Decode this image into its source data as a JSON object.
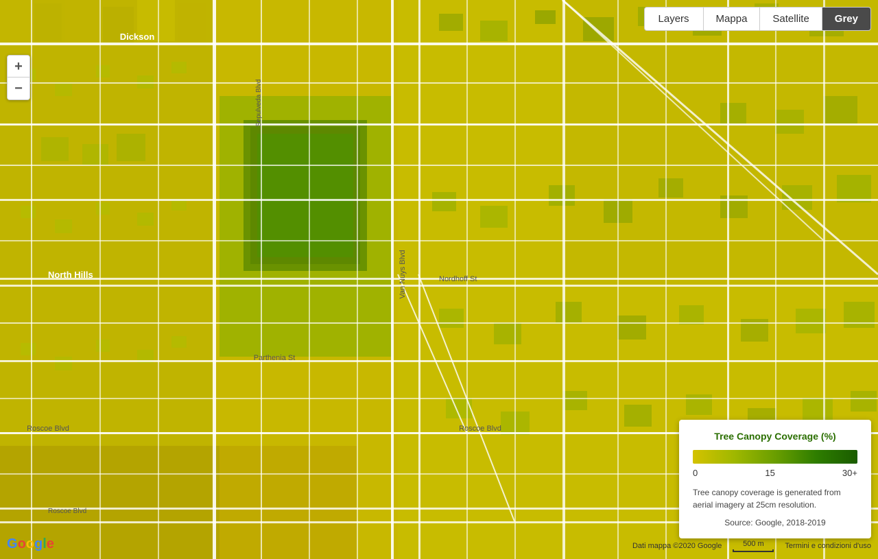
{
  "controls": {
    "layers_label": "Layers",
    "mappa_label": "Mappa",
    "satellite_label": "Satellite",
    "grey_label": "Grey",
    "zoom_in": "+",
    "zoom_out": "−"
  },
  "legend": {
    "title": "Tree Canopy Coverage (%)",
    "label_low": "0",
    "label_mid": "15",
    "label_high": "30+",
    "description": "Tree canopy coverage is generated from aerial imagery at 25cm resolution.",
    "source": "Source: Google, 2018-2019"
  },
  "footer": {
    "copyright": "Dati mappa ©2020 Google",
    "scale": "500 m",
    "terms": "Termini e condizioni d'uso"
  },
  "google_logo": "Google"
}
